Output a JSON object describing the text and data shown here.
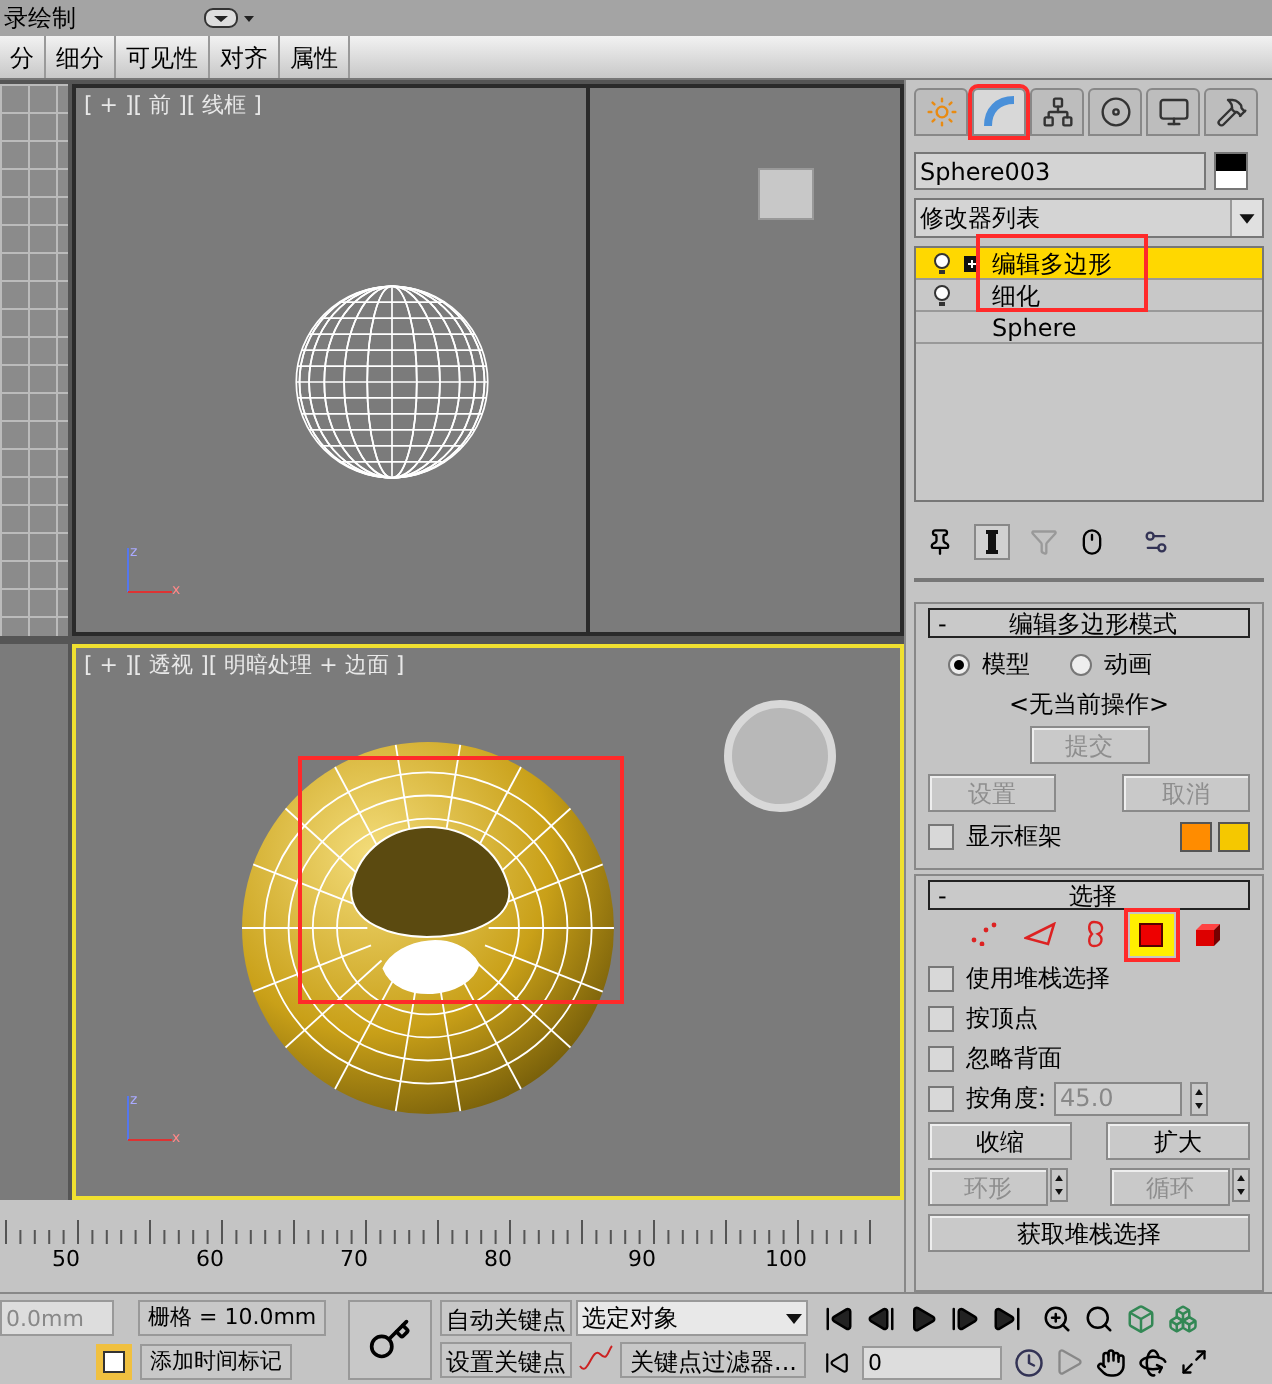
{
  "title_bar": {
    "text": "录绘制"
  },
  "ribbon_tabs": [
    {
      "label": "分"
    },
    {
      "label": "细分"
    },
    {
      "label": "可见性"
    },
    {
      "label": "对齐"
    },
    {
      "label": "属性"
    }
  ],
  "viewports": [
    {
      "label": "[ + ][ 前 ][ 线框 ]",
      "active": false,
      "kind": "wireframe",
      "axis_labels": [
        "z",
        "x"
      ]
    },
    {
      "label": "[ + ][ 透视 ][ 明暗处理 + 边面 ]",
      "active": true,
      "kind": "shaded",
      "axis_labels": [
        "z",
        "x"
      ]
    }
  ],
  "command_panel": {
    "tabs": [
      {
        "kind": "create",
        "selected": false
      },
      {
        "kind": "modify",
        "selected": true
      },
      {
        "kind": "hierarchy",
        "selected": false
      },
      {
        "kind": "motion",
        "selected": false
      },
      {
        "kind": "display",
        "selected": false
      },
      {
        "kind": "utilities",
        "selected": false
      }
    ],
    "object_name": "Sphere003",
    "modifier_list": "修改器列表",
    "stack": [
      {
        "label": "编辑多边形",
        "kind": "modifier",
        "expandable": true,
        "selected": true
      },
      {
        "label": "细化",
        "kind": "modifier",
        "expandable": false,
        "selected": false
      },
      {
        "label": "Sphere",
        "kind": "base",
        "expandable": false,
        "selected": false
      }
    ],
    "rollouts": [
      {
        "glyph": "-",
        "title": "编辑多边形模式",
        "modes": [
          {
            "label": "模型",
            "selected": true
          },
          {
            "label": "动画",
            "selected": false
          }
        ],
        "status": "<无当前操作>",
        "commit": {
          "label": "提交",
          "disabled": true
        },
        "buttons": [
          {
            "label": "设置",
            "disabled": true
          },
          {
            "label": "取消",
            "disabled": true
          }
        ],
        "show_cage": {
          "label": "显示框架",
          "checked": false
        },
        "swatches": [
          {
            "color": "#ff8c00"
          },
          {
            "color": "#f5c800"
          }
        ]
      },
      {
        "glyph": "-",
        "title": "选择",
        "levels": [
          {
            "kind": "vertex",
            "selected": false
          },
          {
            "kind": "edge",
            "selected": false
          },
          {
            "kind": "border",
            "selected": false
          },
          {
            "kind": "polygon",
            "selected": true
          },
          {
            "kind": "element",
            "selected": false
          }
        ],
        "checkboxes": [
          {
            "label": "使用堆栈选择",
            "checked": false
          },
          {
            "label": "按顶点",
            "checked": false
          },
          {
            "label": "忽略背面",
            "checked": false
          }
        ],
        "by_angle": {
          "label": "按角度:",
          "checked": false,
          "value": "45.0",
          "disabled": true
        },
        "grow_shrink": [
          {
            "label": "收缩",
            "disabled": false
          },
          {
            "label": "扩大",
            "disabled": false
          }
        ],
        "ring_loop": [
          {
            "label": "环形",
            "disabled": true
          },
          {
            "label": "循环",
            "disabled": true
          }
        ],
        "get_stack": {
          "label": "获取堆栈选择",
          "disabled": false
        }
      }
    ]
  },
  "timeline": {
    "labels": [
      "50",
      "60",
      "70",
      "80",
      "90",
      "100"
    ]
  },
  "status_bar": {
    "coord_field": "0.0mm",
    "grid": "栅格 = 10.0mm",
    "add_tag": "添加时间标记",
    "auto_key": "自动关键点",
    "set_key": "设置关键点",
    "key_target": "选定对象",
    "key_filters": "关键点过滤器...",
    "frame": "0"
  }
}
